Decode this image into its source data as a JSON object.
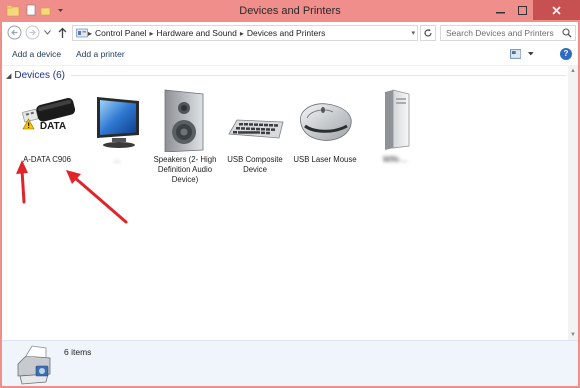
{
  "window": {
    "title": "Devices and Printers"
  },
  "address": {
    "crumbs": [
      "Control Panel",
      "Hardware and Sound",
      "Devices and Printers"
    ]
  },
  "search": {
    "placeholder": "Search Devices and Printers"
  },
  "toolbar": {
    "add_device": "Add a device",
    "add_printer": "Add a printer",
    "help": "?"
  },
  "group": {
    "label": "Devices (6)"
  },
  "devices": [
    {
      "name": "A-DATA C906",
      "icon": "usb-flash-drive-icon",
      "badge": "warning-icon"
    },
    {
      "name": "...",
      "icon": "computer-monitor-icon"
    },
    {
      "name": "Speakers (2- High Definition Audio Device)",
      "icon": "speakers-icon"
    },
    {
      "name": "USB Composite Device",
      "icon": "keyboard-icon"
    },
    {
      "name": "USB Laser Mouse",
      "icon": "mouse-icon"
    },
    {
      "name": "WIN-...",
      "icon": "pc-tower-icon"
    }
  ],
  "status": {
    "count": "6 items"
  },
  "colors": {
    "titlebar": "#ef8e8a",
    "close_button": "#c75050",
    "annotation_arrow": "#e0252a",
    "group_header": "#1e3287"
  }
}
